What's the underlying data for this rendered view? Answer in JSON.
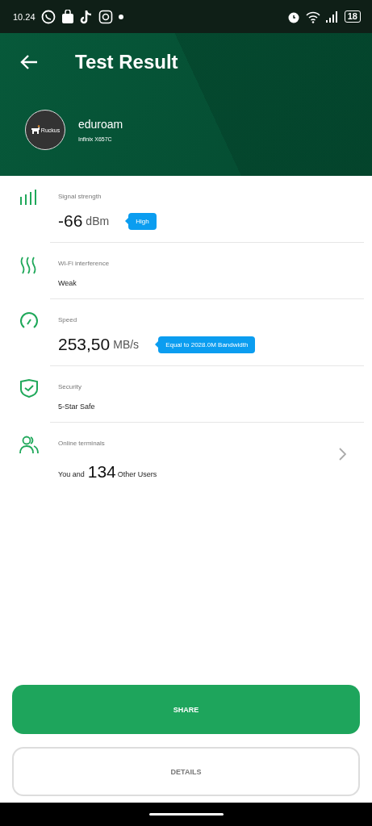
{
  "status_bar": {
    "time": "10.24",
    "battery": "18"
  },
  "header": {
    "title": "Test Result",
    "network": {
      "logo_text": "Ruckus",
      "name": "eduroam",
      "device": "Infinix X657C"
    }
  },
  "rows": [
    {
      "kind": "reading",
      "label": "Signal strength",
      "value": "-66",
      "unit": "dBm",
      "tag": "High"
    },
    {
      "kind": "text",
      "label": "Wi-Fi interference",
      "value": "Weak"
    },
    {
      "kind": "reading",
      "label": "Speed",
      "value": "253,50",
      "unit": "MB/s",
      "tag": "Equal to 2028.0M Bandwidth"
    },
    {
      "kind": "text",
      "label": "Security",
      "value": "5-Star Safe"
    },
    {
      "kind": "users",
      "label": "Online terminals",
      "prefix": "You and",
      "count": "134",
      "suffix": "Other Users"
    }
  ],
  "buttons": [
    {
      "kind": "primary",
      "label": "SHARE"
    },
    {
      "kind": "outline",
      "label": "DETAILS"
    }
  ]
}
